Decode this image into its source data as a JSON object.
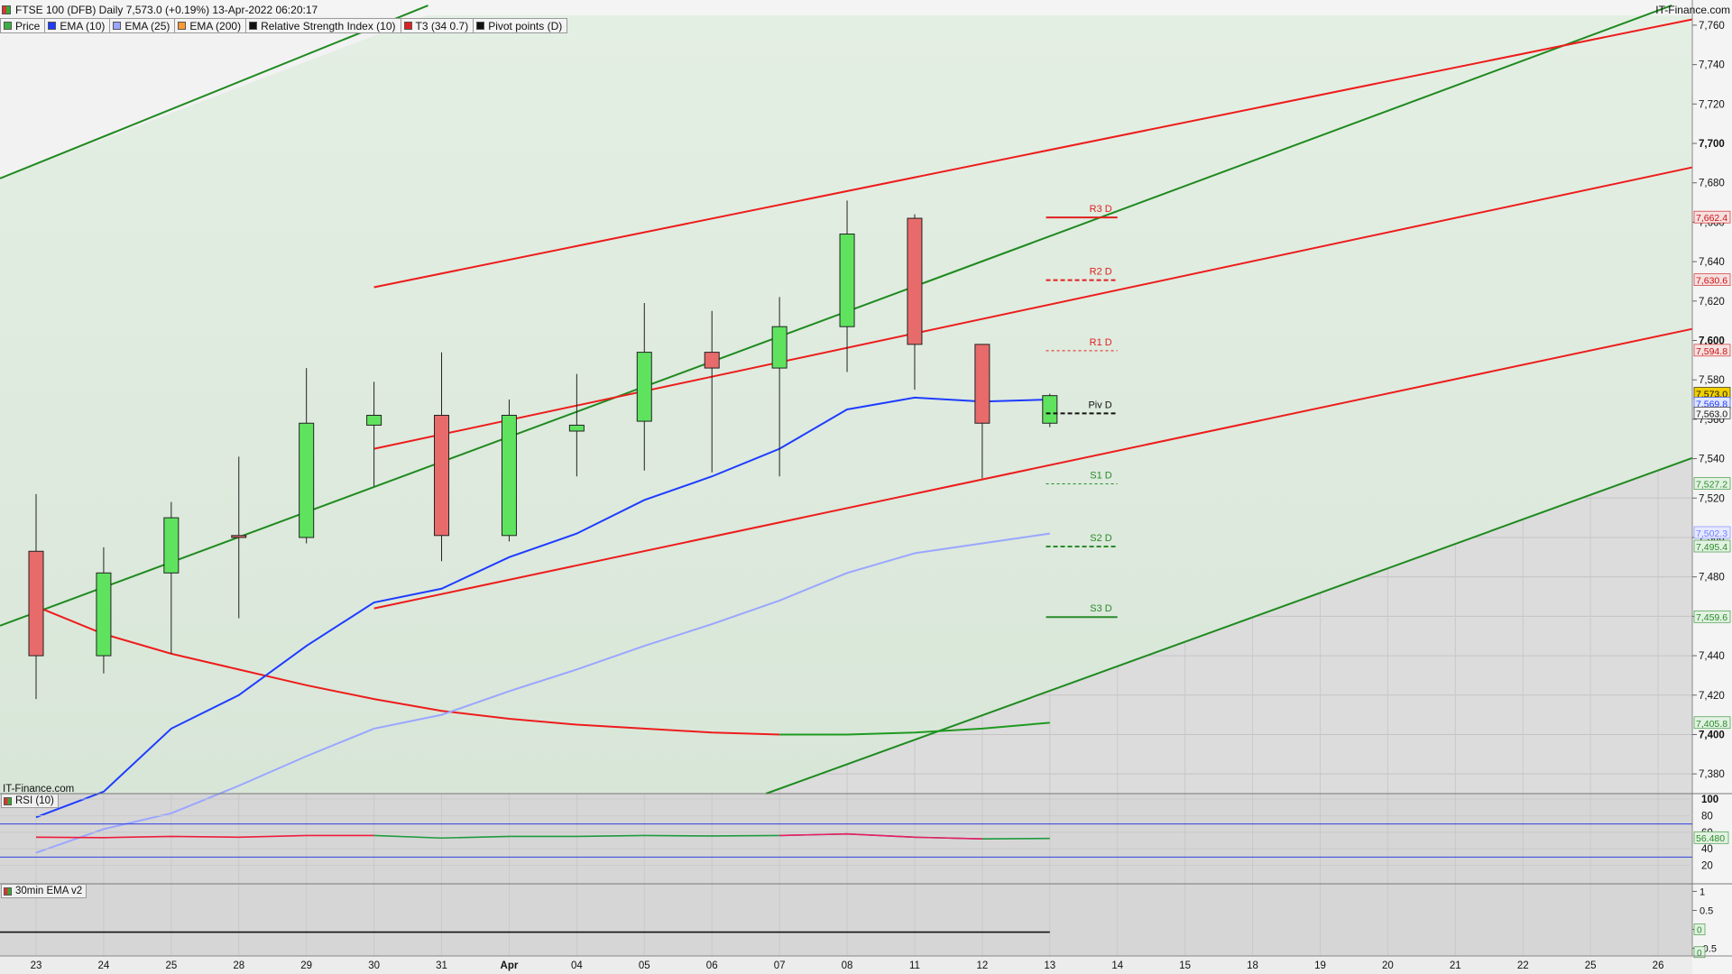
{
  "header": {
    "title": "FTSE 100 (DFB) Daily 7,573.0 (+0.19%) 13-Apr-2022 06:20:17",
    "brand": "IT-Finance.com",
    "watermark": "IT-Finance.com"
  },
  "legend": [
    {
      "label": "Price",
      "color": "#3cb043"
    },
    {
      "label": "EMA (10)",
      "color": "#1e3cff"
    },
    {
      "label": "EMA (25)",
      "color": "#9aa6ff"
    },
    {
      "label": "EMA (200)",
      "color": "#ff9933"
    },
    {
      "label": "Relative Strength Index (10)",
      "color": "#111111"
    },
    {
      "label": "T3 (34 0.7)",
      "color": "#e02020"
    },
    {
      "label": "Pivot points (D)",
      "color": "#111111"
    }
  ],
  "panels": {
    "rsi_label": "RSI (10)",
    "ema_label": "30min EMA v2"
  },
  "chart_data": {
    "type": "candlestick",
    "x_labels": [
      "23",
      "24",
      "25",
      "28",
      "29",
      "30",
      "31",
      "Apr",
      "04",
      "05",
      "06",
      "07",
      "08",
      "11",
      "12",
      "13",
      "14",
      "15",
      "18",
      "19",
      "20",
      "21",
      "22",
      "25",
      "26"
    ],
    "y_ticks": [
      7380,
      7400,
      7420,
      7440,
      7460,
      7480,
      7500,
      7520,
      7540,
      7560,
      7580,
      7600,
      7620,
      7640,
      7660,
      7680,
      7700,
      7720,
      7740,
      7760
    ],
    "y_bold_ticks": [
      7400,
      7600,
      7700
    ],
    "ylim": [
      7370,
      7765
    ],
    "candles": [
      {
        "o": 7493,
        "h": 7522,
        "l": 7418,
        "c": 7440
      },
      {
        "o": 7440,
        "h": 7495,
        "l": 7431,
        "c": 7482
      },
      {
        "o": 7482,
        "h": 7518,
        "l": 7441,
        "c": 7510
      },
      {
        "o": 7501,
        "h": 7541,
        "l": 7459,
        "c": 7500
      },
      {
        "o": 7500,
        "h": 7586,
        "l": 7497,
        "c": 7558
      },
      {
        "o": 7557,
        "h": 7579,
        "l": 7526,
        "c": 7562
      },
      {
        "o": 7562,
        "h": 7594,
        "l": 7488,
        "c": 7501
      },
      {
        "o": 7501,
        "h": 7570,
        "l": 7498,
        "c": 7562
      },
      {
        "o": 7554,
        "h": 7583,
        "l": 7531,
        "c": 7557
      },
      {
        "o": 7559,
        "h": 7619,
        "l": 7534,
        "c": 7594
      },
      {
        "o": 7594,
        "h": 7615,
        "l": 7533,
        "c": 7586
      },
      {
        "o": 7586,
        "h": 7622,
        "l": 7531,
        "c": 7607
      },
      {
        "o": 7607,
        "h": 7671,
        "l": 7584,
        "c": 7654
      },
      {
        "o": 7662,
        "h": 7664,
        "l": 7575,
        "c": 7598
      },
      {
        "o": 7598,
        "h": 7598,
        "l": 7530,
        "c": 7558
      },
      {
        "o": 7558,
        "h": 7573,
        "l": 7556,
        "c": 7572
      }
    ],
    "ema10": [
      7358,
      7371,
      7403,
      7420,
      7445,
      7467,
      7474,
      7490,
      7502,
      7519,
      7531,
      7545,
      7565,
      7571,
      7569,
      7570
    ],
    "ema25": [
      7340,
      7352,
      7360,
      7374,
      7389,
      7403,
      7410,
      7422,
      7433,
      7445,
      7456,
      7468,
      7482,
      7492,
      7497,
      7502
    ],
    "ema200": [
      7465,
      7451,
      7441,
      7433,
      7425,
      7418,
      7412,
      7408,
      7405,
      7403,
      7401,
      7400,
      7400,
      7401,
      7403,
      7406
    ],
    "regression_upper": {
      "x0": 5,
      "y0": 7627,
      "x1": 24.8,
      "y1": 7765
    },
    "regression_mid": {
      "x0": 5,
      "y0": 7545,
      "x1": 24.8,
      "y1": 7690
    },
    "regression_lower": {
      "x0": 5,
      "y0": 7464,
      "x1": 24.8,
      "y1": 7608
    },
    "channel_shade": {
      "x0": 5,
      "x1": 24.8
    },
    "green_trend_upper": {
      "x0": -0.55,
      "y0": 7682,
      "x1": 5.8,
      "y1": 7770
    },
    "green_trend_mid": {
      "x0": -0.55,
      "y0": 7455,
      "x1": 24.2,
      "y1": 7770
    },
    "green_trend_lower": {
      "x0": 10.8,
      "y0": 7370,
      "x1": 24.8,
      "y1": 7544
    },
    "pivots": [
      {
        "label": "R3 D",
        "value": 7662.4,
        "color": "#e02020",
        "style": "solid"
      },
      {
        "label": "R2 D",
        "value": 7630.6,
        "color": "#e02020",
        "style": "dashed"
      },
      {
        "label": "R1 D",
        "value": 7594.8,
        "color": "#e02020",
        "style": "dotted"
      },
      {
        "label": "Piv D",
        "value": 7563.0,
        "color": "#111111",
        "style": "dashed"
      },
      {
        "label": "S1 D",
        "value": 7527.2,
        "color": "#2a8a2a",
        "style": "dotted"
      },
      {
        "label": "S2 D",
        "value": 7495.4,
        "color": "#2a8a2a",
        "style": "dashed"
      },
      {
        "label": "S3 D",
        "value": 7459.6,
        "color": "#2a8a2a",
        "style": "solid"
      }
    ],
    "price_tags": [
      {
        "text": "7,662.4",
        "value": 7662.4,
        "fg": "#d01010",
        "bg": "#f5e0e0"
      },
      {
        "text": "7,630.6",
        "value": 7630.6,
        "fg": "#d01010",
        "bg": "#f5e0e0"
      },
      {
        "text": "7,594.8",
        "value": 7594.8,
        "fg": "#d01010",
        "bg": "#f5e0e0"
      },
      {
        "text": "7,573.0",
        "value": 7573.0,
        "fg": "#111111",
        "bg": "#f2d000"
      },
      {
        "text": "7,569.8",
        "value": 7568.0,
        "fg": "#1e3cff",
        "bg": "#e0e6ff"
      },
      {
        "text": "7,563.0",
        "value": 7563.0,
        "fg": "#111111",
        "bg": "#f4f4f4"
      },
      {
        "text": "7,527.2",
        "value": 7527.2,
        "fg": "#2a8a2a",
        "bg": "#e2f2e2"
      },
      {
        "text": "7,502.3",
        "value": 7502.3,
        "fg": "#7080ff",
        "bg": "#e6e9ff"
      },
      {
        "text": "7,495.4",
        "value": 7495.4,
        "fg": "#2a8a2a",
        "bg": "#e2f2e2"
      },
      {
        "text": "7,459.6",
        "value": 7459.6,
        "fg": "#2a8a2a",
        "bg": "#e2f2e2"
      },
      {
        "text": "7,405.8",
        "value": 7405.8,
        "fg": "#2a8a2a",
        "bg": "#e2f2e2"
      }
    ],
    "rsi": {
      "values": [
        54,
        53.5,
        55,
        54,
        56,
        56,
        53,
        55,
        55,
        56,
        55.5,
        56,
        58,
        54,
        52,
        52.5
      ],
      "ylim": [
        0,
        100
      ],
      "ticks": [
        100,
        80,
        60,
        40,
        20
      ],
      "levels": [
        70,
        30
      ],
      "tag": "56.480",
      "tag_value": 53
    },
    "ema_panel": {
      "ticks": [
        "1",
        "0.5",
        "0",
        "-0.5"
      ],
      "tick_values": [
        1,
        0.5,
        0,
        -0.5
      ],
      "ylim": [
        -0.7,
        1.2
      ],
      "tags": [
        "0",
        "0"
      ],
      "tag_values": [
        0,
        -0.6
      ]
    }
  }
}
